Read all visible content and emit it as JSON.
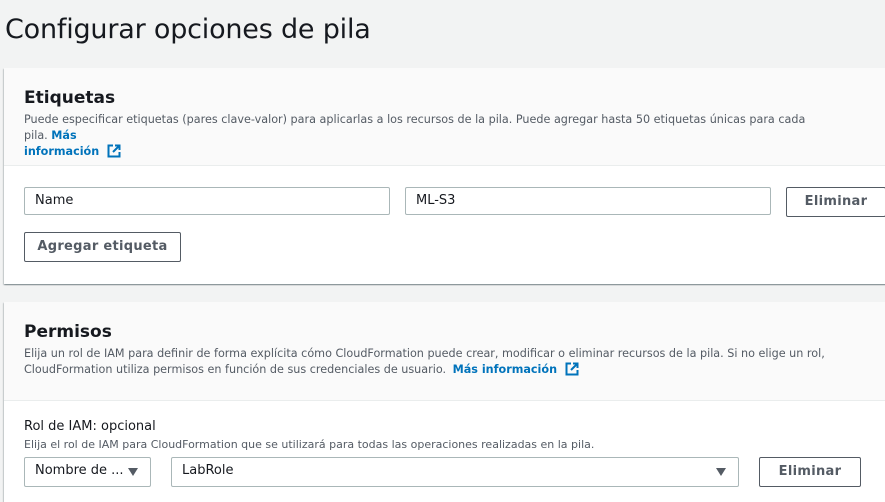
{
  "page": {
    "title": "Configurar opciones de pila"
  },
  "tags": {
    "title": "Etiquetas",
    "description": "Puede especificar etiquetas (pares clave-valor) para aplicarlas a los recursos de la pila. Puede agregar hasta 50 etiquetas únicas para cada pila.",
    "more_info_part1": "Más",
    "more_info_part2": "información",
    "key_value": "Name",
    "value_value": "ML-S3",
    "remove_label": "Eliminar",
    "add_label": "Agregar etiqueta"
  },
  "permissions": {
    "title": "Permisos",
    "description_line1": "Elija un rol de IAM para definir de forma explícita cómo CloudFormation puede crear, modificar o eliminar recursos de la pila. Si no elige un rol,",
    "description_line2": "CloudFormation utiliza permisos en función de sus credenciales de usuario.",
    "more_info": "Más información",
    "role_label": "Rol de IAM: opcional",
    "role_hint": "Elija el rol de IAM para CloudFormation que se utilizará para todas las operaciones realizadas en la pila.",
    "role_type_selected": "Nombre de ...",
    "role_selected": "LabRole",
    "remove_label": "Eliminar"
  },
  "colors": {
    "link": "#0073bb",
    "text": "#16191f",
    "muted": "#545b64",
    "border": "#aab7b8",
    "background": "#f2f3f3"
  },
  "icons": {
    "external_link": "external-link-icon",
    "dropdown": "caret-down-icon"
  }
}
